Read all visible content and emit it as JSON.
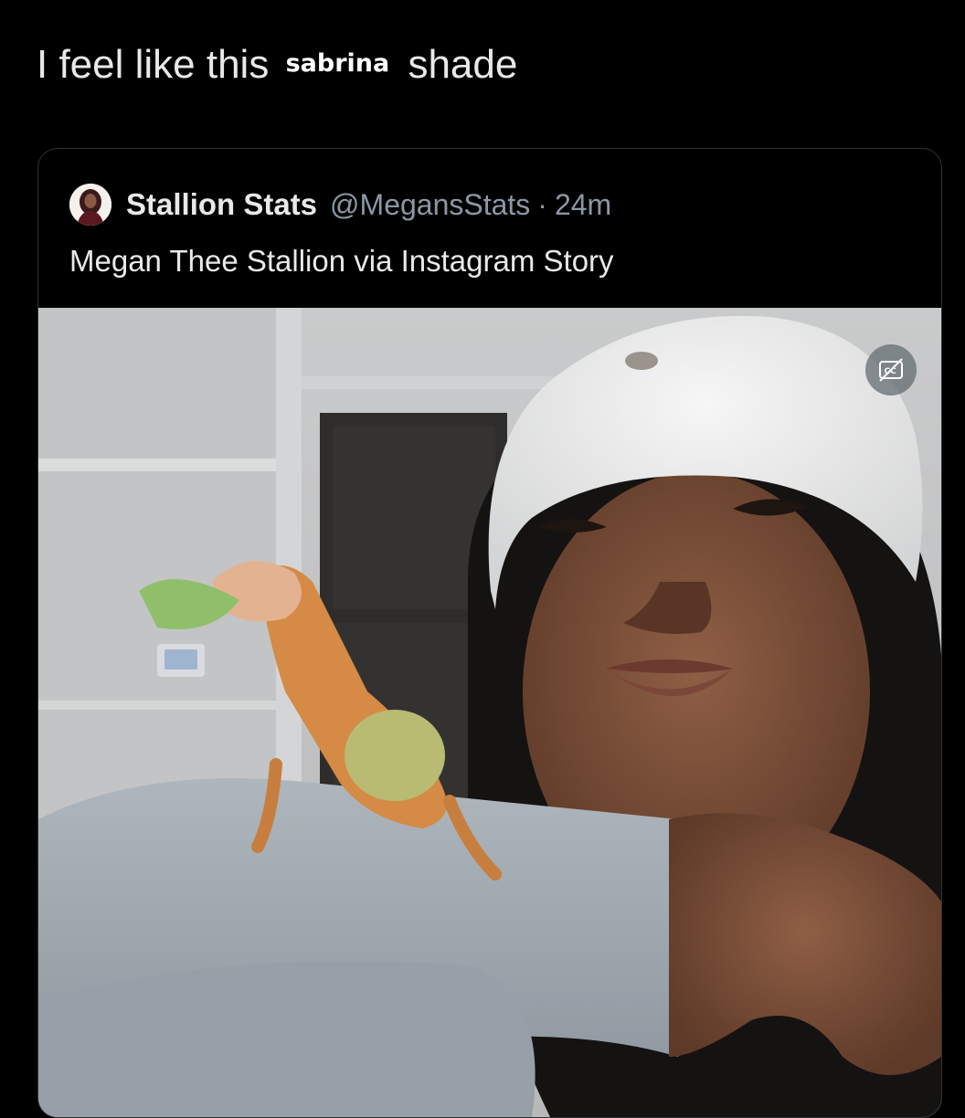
{
  "tweet": {
    "text_before": "I feel like this",
    "overlay_word": "sabrina",
    "text_after": "shade"
  },
  "quote": {
    "display_name": "Stallion Stats",
    "handle": "@MegansStats",
    "separator": "·",
    "time": "24m",
    "text": "Megan Thee Stallion via Instagram Story"
  },
  "media": {
    "icon": "closed-captions-off-icon"
  },
  "colors": {
    "background": "#000000",
    "primary_text": "#e7e9ea",
    "secondary_text": "#8b98a5",
    "card_border": "#2f3336"
  }
}
